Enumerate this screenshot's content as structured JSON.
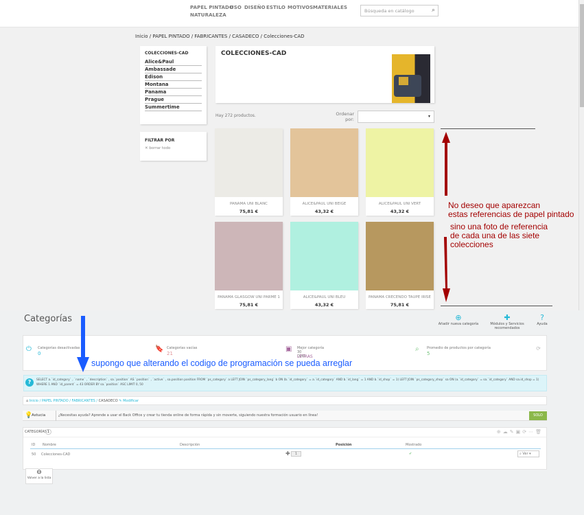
{
  "store": {
    "nav": [
      "PAPEL PINTADO",
      "USO",
      "DISEÑO",
      "ESTILO",
      "MOTIVOS",
      "MATERIALES",
      "NATURALEZA"
    ],
    "search_placeholder": "Búsqueda en catálogo",
    "breadcrumb": "Inicio / PAPEL PINTADO / FABRICANTES / CASADECO / Colecciones-CAD",
    "sidebar": {
      "title": "COLECCIONES-CAD",
      "items": [
        "Alice&Paul",
        "Ambassade",
        "Edison",
        "Montana",
        "Panama",
        "Prague",
        "Summertime"
      ]
    },
    "filter": {
      "title": "FILTRAR POR",
      "clear": "borrar todo"
    },
    "category_title": "COLECCIONES-CAD",
    "count": "Hay 272 productos.",
    "sort_label": "Ordenar por:",
    "products": [
      {
        "name": "PANAMA UNI BLANC",
        "price": "75,81 €",
        "color": "#ecebe6"
      },
      {
        "name": "ALICE&PAUL UNI BEIGE",
        "price": "43,32 €",
        "color": "#e3c49a"
      },
      {
        "name": "ALICE&PAUL UNI VERT",
        "price": "43,32 €",
        "color": "#eef3a4"
      },
      {
        "name": "PANAMA GLASGOW UNI PARME 1",
        "price": "75,81 €",
        "color": "#cdb6b8"
      },
      {
        "name": "ALICE&PAUL UNI BLEU",
        "price": "43,32 €",
        "color": "#b0f0e0"
      },
      {
        "name": "PANAMA CRECENDO TAUPE IRISE",
        "price": "75,81 €",
        "color": "#b7985f"
      }
    ]
  },
  "annotations": {
    "red1": "No deseo que aparezcan",
    "red2": " estas referencias de papel pintado",
    "red3": "sino una foto de referencia",
    "red4": "de cada una de las siete",
    "red5": " colecciones",
    "blue": "supongo que alterando el codigo de programación se pueda arreglar"
  },
  "admin": {
    "title": "Categorías",
    "actions": [
      "Añadir nueva categoría",
      "Módulos y Servicios recomendados",
      "Ayuda"
    ],
    "kpis": [
      {
        "label": "Categorías desactivadas",
        "value": "0",
        "color": "#25b9d7"
      },
      {
        "label": "Categorías vacías",
        "value": "21",
        "color": "#e08f95"
      },
      {
        "label": "Mejor categoría",
        "sub": "30 DÍAS",
        "value": "LETRAS",
        "color": "#a6689e"
      },
      {
        "label": "Promedio de productos por categoría",
        "value": "5",
        "color": "#72c279"
      }
    ],
    "sql": "SELECT a.`id_category` , `name` , `description` , sa.`position` AS `position` , `active` , sa.position position FROM `ps_category` a LEFT JOIN `ps_category_lang` b ON (b.`id_category` = a.`id_category` AND b.`id_lang` = 1 AND b.`id_shop` = 1) LEFT JOIN `ps_category_shop` sa ON (a.`id_category` = sa.`id_category` AND sa.id_shop = 1) WHERE 1 AND `id_parent` = 43 ORDER BY sa.`position` ASC LIMIT 0, 50",
    "breadcrumb": [
      "Inicio",
      "PAPEL PINTADO",
      "FABRICANTES",
      "CASADECO"
    ],
    "modify": "Modificar",
    "tip_label": "Astucia",
    "tip_text": "¿Necesitas ayuda? Aprende a usar el Back Office y crear tu tienda online de forma rápida y sin moverte, siguiendo nuestra formación usuario en línea!",
    "tip_button": "SOLO",
    "list_title": "CATEGORÍAS",
    "list_count": "1",
    "columns": [
      "ID",
      "Nombre",
      "Descripción",
      "Posición",
      "Mostrado"
    ],
    "rows": [
      {
        "id": "50",
        "name": "Colecciones-CAD",
        "description": "",
        "position": "1",
        "shown": "✔",
        "action": "Ver"
      }
    ],
    "back": "Volver a la lista"
  }
}
